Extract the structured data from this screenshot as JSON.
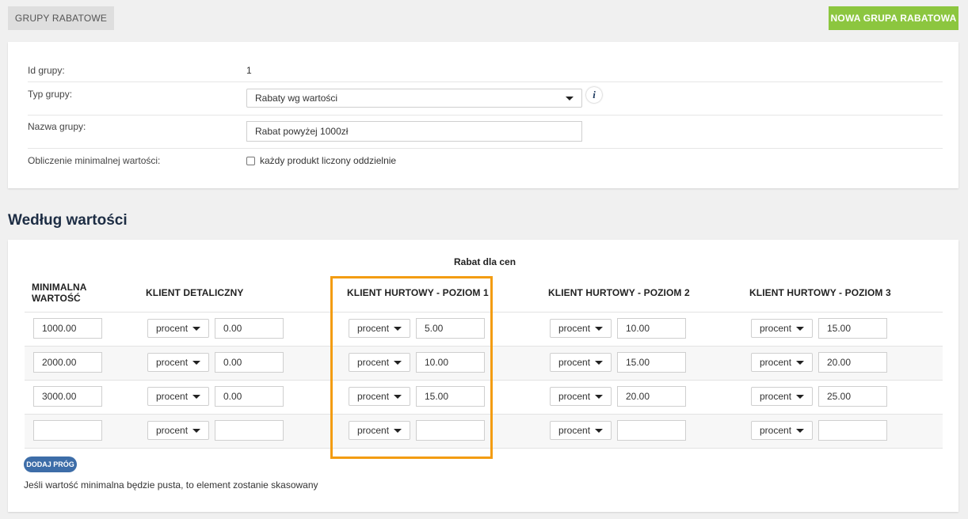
{
  "header": {
    "tab_label": "GRUPY RABATOWE",
    "new_button_label": "NOWA GRUPA RABATOWA"
  },
  "group_form": {
    "id_label": "Id grupy:",
    "id_value": "1",
    "type_label": "Typ grupy:",
    "type_value": "Rabaty wg wartości",
    "name_label": "Nazwa grupy:",
    "name_value": "Rabat powyżej 1000zł",
    "calc_label": "Obliczenie minimalnej wartości:",
    "calc_checkbox_label": "każdy produkt liczony oddzielnie",
    "calc_checked": false,
    "info_icon": "info-icon"
  },
  "by_value": {
    "section_title": "Według wartości",
    "rabat_header": "Rabat dla cen",
    "columns": {
      "min": [
        "MINIMALNA",
        "WARTOŚĆ"
      ],
      "c1": "KLIENT DETALICZNY",
      "c2": "KLIENT HURTOWY - POZIOM 1",
      "c3": "KLIENT HURTOWY - POZIOM 2",
      "c4": "KLIENT HURTOWY - POZIOM 3"
    },
    "rows": [
      {
        "min": "1000.00",
        "cells": [
          {
            "type": "procent",
            "value": "0.00"
          },
          {
            "type": "procent",
            "value": "5.00"
          },
          {
            "type": "procent",
            "value": "10.00"
          },
          {
            "type": "procent",
            "value": "15.00"
          }
        ]
      },
      {
        "min": "2000.00",
        "cells": [
          {
            "type": "procent",
            "value": "0.00"
          },
          {
            "type": "procent",
            "value": "10.00"
          },
          {
            "type": "procent",
            "value": "15.00"
          },
          {
            "type": "procent",
            "value": "20.00"
          }
        ]
      },
      {
        "min": "3000.00",
        "cells": [
          {
            "type": "procent",
            "value": "0.00"
          },
          {
            "type": "procent",
            "value": "15.00"
          },
          {
            "type": "procent",
            "value": "20.00"
          },
          {
            "type": "procent",
            "value": "25.00"
          }
        ]
      },
      {
        "min": "",
        "cells": [
          {
            "type": "procent",
            "value": ""
          },
          {
            "type": "procent",
            "value": ""
          },
          {
            "type": "procent",
            "value": ""
          },
          {
            "type": "procent",
            "value": ""
          }
        ]
      }
    ],
    "add_button_label": "DODAJ PRÓG",
    "note": "Jeśli wartość minimalna będzie pusta, to element zostanie skasowany"
  },
  "colors": {
    "accent_green": "#8cc63f",
    "button_blue": "#3d6da8",
    "highlight_orange": "#f39c12",
    "title_navy": "#1d2d44"
  }
}
